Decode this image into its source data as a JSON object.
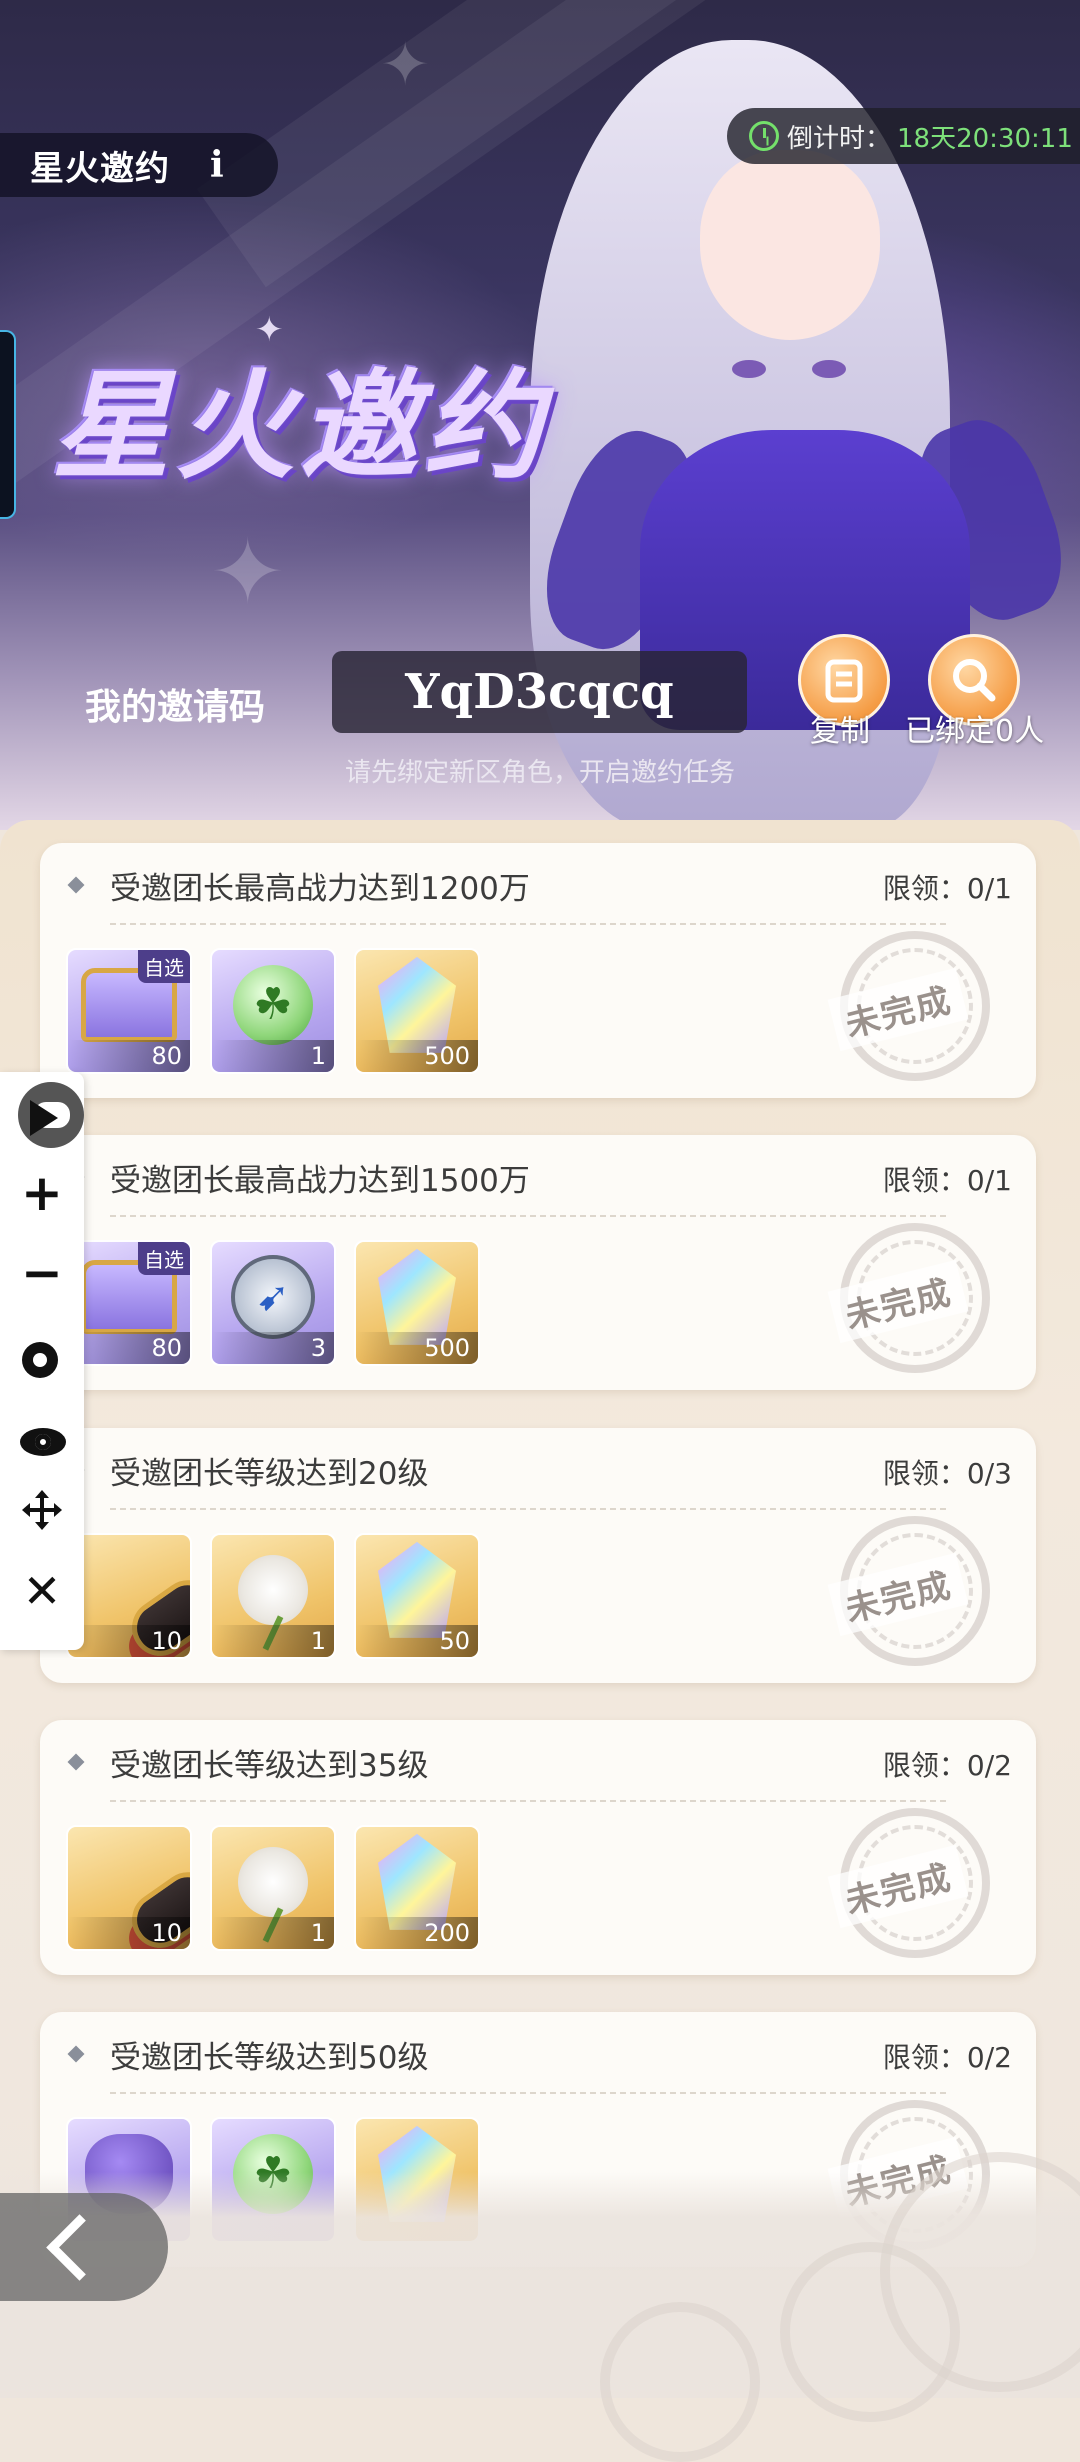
{
  "header": {
    "title": "星火邀约",
    "info_label": "i",
    "countdown_label": "倒计时：",
    "countdown_value": "18天20:30:11",
    "banner_title": "星火邀约"
  },
  "invite": {
    "code_label": "我的邀请码",
    "code_value": "YqD3cqcq",
    "copy_label": "复制",
    "bound_label": "已绑定0人",
    "hint": "请先绑定新区角色，开启邀约任务"
  },
  "tasks": [
    {
      "title": "受邀团长最高战力达到1200万",
      "limit": "限领：0/1",
      "status": "未完成",
      "rewards": [
        {
          "icon": "chest-icon",
          "qty": "80",
          "tag": "自选"
        },
        {
          "icon": "clover-orb-icon",
          "qty": "1"
        },
        {
          "icon": "crystal-icon",
          "qty": "500"
        }
      ]
    },
    {
      "title": "受邀团长最高战力达到1500万",
      "limit": "限领：0/1",
      "status": "未完成",
      "rewards": [
        {
          "icon": "chest-icon",
          "qty": "80",
          "tag": "自选"
        },
        {
          "icon": "compass-icon",
          "qty": "3"
        },
        {
          "icon": "crystal-icon",
          "qty": "500"
        }
      ]
    },
    {
      "title": "受邀团长等级达到20级",
      "limit": "限领：0/3",
      "status": "未完成",
      "rewards": [
        {
          "icon": "scroll-icon",
          "qty": "10"
        },
        {
          "icon": "dandelion-icon",
          "qty": "1"
        },
        {
          "icon": "crystal-icon",
          "qty": "50"
        }
      ]
    },
    {
      "title": "受邀团长等级达到35级",
      "limit": "限领：0/2",
      "status": "未完成",
      "rewards": [
        {
          "icon": "scroll-icon",
          "qty": "10"
        },
        {
          "icon": "dandelion-icon",
          "qty": "1"
        },
        {
          "icon": "crystal-icon",
          "qty": "200"
        }
      ]
    },
    {
      "title": "受邀团长等级达到50级",
      "limit": "限领：0/2",
      "status": "未完成",
      "rewards": [
        {
          "icon": "pouch-icon",
          "qty": ""
        },
        {
          "icon": "clover-orb-icon",
          "qty": ""
        },
        {
          "icon": "crystal-icon",
          "qty": ""
        }
      ]
    }
  ],
  "toolbar": {
    "icons": [
      "play-icon",
      "chat-icon",
      "plus-icon",
      "minus-icon",
      "gear-icon",
      "eye-icon",
      "move-icon",
      "close-icon"
    ]
  },
  "colors": {
    "countdown_value": "#7de07a",
    "accent_orange": "#f59d46",
    "banner_dark": "#2e2a48"
  }
}
